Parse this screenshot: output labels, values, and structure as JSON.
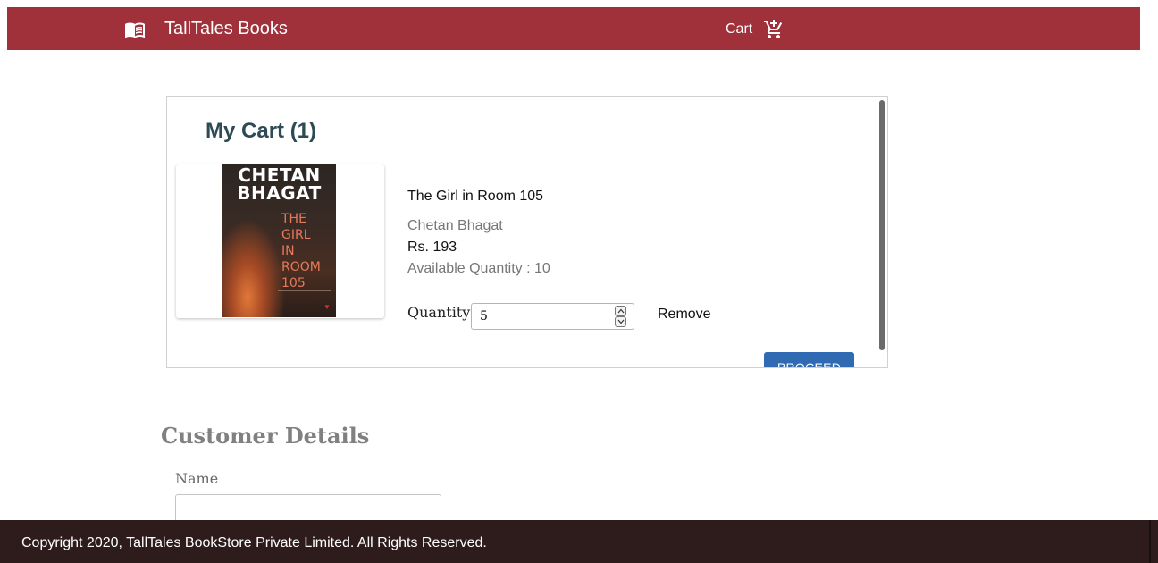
{
  "header": {
    "brand_icon": "open-book-icon",
    "brand_title": "TallTales Books",
    "cart_label": "Cart",
    "cart_icon": "add-shopping-cart-icon",
    "bar_color": "#a0303a"
  },
  "cart": {
    "title": "My Cart (1)",
    "item": {
      "cover": {
        "author_line1": "CHETAN",
        "author_line2": "BHAGAT",
        "title_lines": [
          "THE",
          "GIRL",
          "IN",
          "ROOM",
          "105"
        ]
      },
      "title": "The Girl in Room 105",
      "author": "Chetan Bhagat",
      "price": "Rs. 193",
      "available": "Available Quantity : 10",
      "quantity_label": "Quantity:",
      "quantity_value": "5",
      "remove_label": "Remove"
    },
    "proceed_label": "PROCEED",
    "proceed_color": "#2f6ab3"
  },
  "customer": {
    "heading": "Customer Details",
    "name_label": "Name",
    "name_value": ""
  },
  "footer": {
    "text": "Copyright 2020, TallTales BookStore Private Limited. All Rights Reserved.",
    "color": "#2e1c1d"
  }
}
